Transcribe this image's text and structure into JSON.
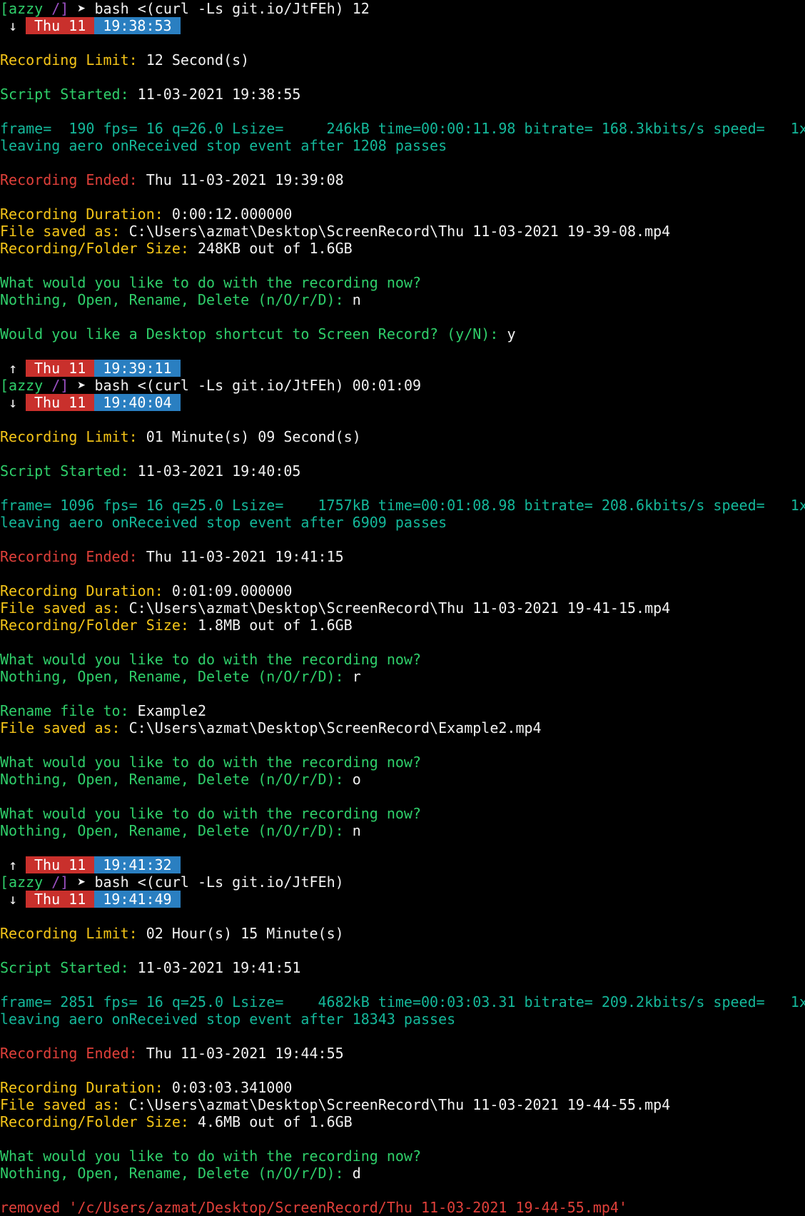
{
  "session1": {
    "prompt_user": "[azzy",
    "prompt_dir": "/]",
    "prompt_arrow": "➤",
    "command": "bash <(curl -Ls git.io/JtFEh) 12",
    "start_badge": {
      "arrow": "↓",
      "day": "Thu 11",
      "time": "19:38:53"
    },
    "limit_label": "Recording Limit:",
    "limit_value": "12 Second(s)",
    "started_label": "Script Started:",
    "started_value": "11-03-2021 19:38:55",
    "ffmpeg_line": "frame=  190 fps= 16 q=26.0 Lsize=     246kB time=00:00:11.98 bitrate= 168.3kbits/s speed=   1x",
    "aero_line": "leaving aero onReceived stop event after 1208 passes",
    "ended_label": "Recording Ended:",
    "ended_value": "Thu 11-03-2021 19:39:08",
    "duration_label": "Recording Duration:",
    "duration_value": "0:00:12.000000",
    "saved_label": "File saved as:",
    "saved_value": "C:\\Users\\azmat\\Desktop\\ScreenRecord\\Thu 11-03-2021 19-39-08.mp4",
    "size_label": "Recording/Folder Size:",
    "size_value": "248KB out of 1.6GB",
    "question": "What would you like to do with the recording now?",
    "options_prompt": "Nothing, Open, Rename, Delete (n/O/r/D):",
    "options_answer": "n",
    "shortcut_prompt": "Would you like a Desktop shortcut to Screen Record? (y/N):",
    "shortcut_answer": "y",
    "end_badge": {
      "arrow": "↑",
      "day": "Thu 11",
      "time": "19:39:11"
    }
  },
  "session2": {
    "prompt_user": "[azzy",
    "prompt_dir": "/]",
    "prompt_arrow": "➤",
    "command": "bash <(curl -Ls git.io/JtFEh) 00:01:09",
    "start_badge": {
      "arrow": "↓",
      "day": "Thu 11",
      "time": "19:40:04"
    },
    "limit_label": "Recording Limit:",
    "limit_value": "01 Minute(s) 09 Second(s)",
    "started_label": "Script Started:",
    "started_value": "11-03-2021 19:40:05",
    "ffmpeg_line": "frame= 1096 fps= 16 q=25.0 Lsize=    1757kB time=00:01:08.98 bitrate= 208.6kbits/s speed=   1x",
    "aero_line": "leaving aero onReceived stop event after 6909 passes",
    "ended_label": "Recording Ended:",
    "ended_value": "Thu 11-03-2021 19:41:15",
    "duration_label": "Recording Duration:",
    "duration_value": "0:01:09.000000",
    "saved_label": "File saved as:",
    "saved_value": "C:\\Users\\azmat\\Desktop\\ScreenRecord\\Thu 11-03-2021 19-41-15.mp4",
    "size_label": "Recording/Folder Size:",
    "size_value": "1.8MB out of 1.6GB",
    "question": "What would you like to do with the recording now?",
    "options_prompt": "Nothing, Open, Rename, Delete (n/O/r/D):",
    "answer_1": "r",
    "rename_label": "Rename file to:",
    "rename_value": "Example2",
    "saved2_label": "File saved as:",
    "saved2_value": "C:\\Users\\azmat\\Desktop\\ScreenRecord\\Example2.mp4",
    "answer_2": "o",
    "answer_3": "n",
    "end_badge": {
      "arrow": "↑",
      "day": "Thu 11",
      "time": "19:41:32"
    }
  },
  "session3": {
    "prompt_user": "[azzy",
    "prompt_dir": "/]",
    "prompt_arrow": "➤",
    "command": "bash <(curl -Ls git.io/JtFEh)",
    "start_badge": {
      "arrow": "↓",
      "day": "Thu 11",
      "time": "19:41:49"
    },
    "limit_label": "Recording Limit:",
    "limit_value": "02 Hour(s) 15 Minute(s)",
    "started_label": "Script Started:",
    "started_value": "11-03-2021 19:41:51",
    "ffmpeg_line": "frame= 2851 fps= 16 q=25.0 Lsize=    4682kB time=00:03:03.31 bitrate= 209.2kbits/s speed=   1x",
    "aero_line": "leaving aero onReceived stop event after 18343 passes",
    "ended_label": "Recording Ended:",
    "ended_value": "Thu 11-03-2021 19:44:55",
    "duration_label": "Recording Duration:",
    "duration_value": "0:03:03.341000",
    "saved_label": "File saved as:",
    "saved_value": "C:\\Users\\azmat\\Desktop\\ScreenRecord\\Thu 11-03-2021 19-44-55.mp4",
    "size_label": "Recording/Folder Size:",
    "size_value": "4.6MB out of 1.6GB",
    "question": "What would you like to do with the recording now?",
    "options_prompt": "Nothing, Open, Rename, Delete (n/O/r/D):",
    "options_answer": "d",
    "removed_line": "removed '/c/Users/azmat/Desktop/ScreenRecord/Thu 11-03-2021 19-44-55.mp4'"
  },
  "colors": {
    "background": "#000000",
    "label_yellow": "#f5c518",
    "label_green": "#2fcf6a",
    "ffmpeg_teal": "#14b89a",
    "label_red": "#e0403a",
    "badge_day_bg": "#c9302c",
    "badge_time_bg": "#2a7fc1"
  }
}
